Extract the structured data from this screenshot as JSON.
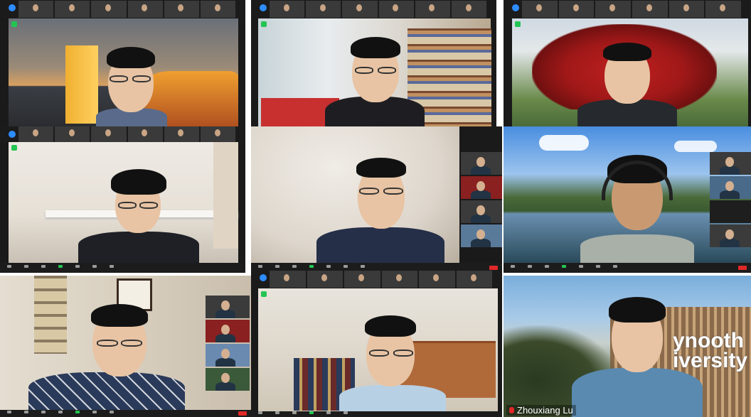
{
  "participants": [
    {
      "id": "p1"
    },
    {
      "id": "p2"
    },
    {
      "id": "p3"
    },
    {
      "id": "p4"
    },
    {
      "id": "p5"
    },
    {
      "id": "p6"
    },
    {
      "id": "p7"
    },
    {
      "id": "p8"
    },
    {
      "id": "p9",
      "display_name": "Zhouxiang Lu"
    }
  ],
  "backgrounds": {
    "p9_building_text": "ynooth\niversity"
  },
  "colors": {
    "zoom_blue": "#2d8cff",
    "video_on_green": "#23c552",
    "end_red": "#e02828",
    "toolbar_bg": "#1c1c1c"
  },
  "icons": [
    "security-shield-icon",
    "video-on-icon",
    "mic-muted-icon",
    "end-meeting-icon"
  ]
}
